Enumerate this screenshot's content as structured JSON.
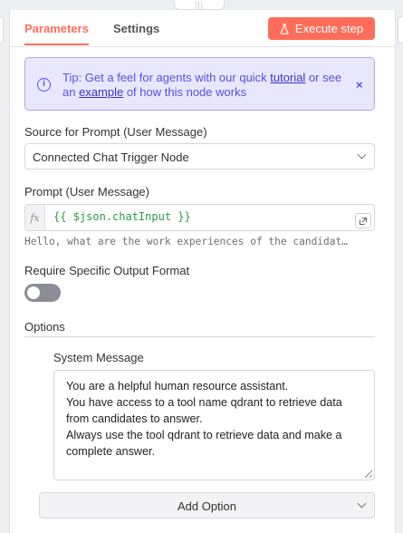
{
  "handle": {
    "glyph": "|||"
  },
  "tabs": [
    {
      "label": "Parameters",
      "active": true
    },
    {
      "label": "Settings",
      "active": false
    }
  ],
  "execute_button": {
    "label": "Execute step",
    "icon": "flask-icon"
  },
  "tip": {
    "prefix": "Tip: Get a feel for agents with our quick ",
    "link1": "tutorial",
    "middle": " or see an ",
    "link2": "example",
    "suffix": " of how this node works",
    "icon": "info-circle-icon",
    "close": "×"
  },
  "source_prompt": {
    "label": "Source for Prompt (User Message)",
    "value": "Connected Chat Trigger Node"
  },
  "prompt": {
    "label": "Prompt (User Message)",
    "fx": "fx",
    "expression": "{{ $json.chatInput }}",
    "preview": "Hello, what are the work experiences of the candidat…"
  },
  "output_format": {
    "label": "Require Specific Output Format",
    "enabled": false
  },
  "options": {
    "label": "Options",
    "system_message": {
      "label": "System Message",
      "lines": [
        "You are a helpful human resource assistant.",
        "You have access to a tool name qdrant to retrieve data",
        "from candidates to answer.",
        "Always use the tool qdrant to retrieve data and make a",
        "complete answer."
      ]
    },
    "add_option": "Add Option"
  },
  "colors": {
    "accent": "#ff6d5a",
    "tip_text": "#5b4ee8",
    "tip_bg": "#e9e7fd",
    "expression": "#2a9d44"
  }
}
